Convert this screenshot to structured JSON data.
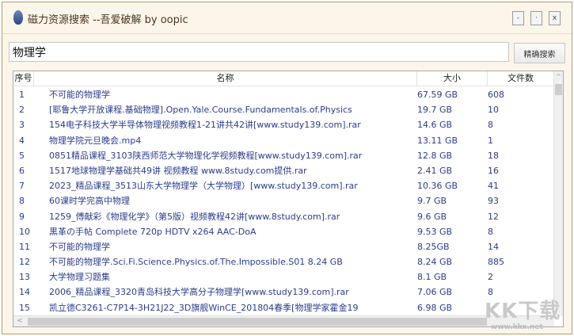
{
  "window": {
    "title": "磁力资源搜索 --吾爱破解 by oopic",
    "buttons": [
      "-",
      "·",
      "x"
    ]
  },
  "search": {
    "value": "物理学",
    "button_label": "精确搜索"
  },
  "table": {
    "headers": [
      "序号",
      "名称",
      "大小",
      "文件数"
    ],
    "rows": [
      [
        "1",
        "不可能的物理学",
        "67.59 GB",
        "608"
      ],
      [
        "2",
        "[耶鲁大学开放课程.基础物理].Open.Yale.Course.Fundamentals.of.Physics",
        "19.7 GB",
        "10"
      ],
      [
        "3",
        "154电子科技大学半导体物理视频教程1-21讲共42讲[www.study139.com].rar",
        "14.6 GB",
        "8"
      ],
      [
        "4",
        "物理学院元旦晚会.mp4",
        "13.11 GB",
        "1"
      ],
      [
        "5",
        "0851精品课程_3103陕西师范大学物理化学视频教程[www.study139.com].rar",
        "12.8 GB",
        "18"
      ],
      [
        "6",
        "1517地球物理学基础共49讲 视频教程 www.8study.com提供.rar",
        "2.41 GB",
        "16"
      ],
      [
        "7",
        "2023_精品课程_3513山东大学物理学（大学物理）[www.study139.com].rar",
        "10.36 GB",
        "41"
      ],
      [
        "8",
        "60课时学完高中物理",
        "9.7 GB",
        "93"
      ],
      [
        "9",
        "1259_傅献彩《物理化学》（第5版）视频教程42讲[www.8study.com].rar",
        "9.6 GB",
        "12"
      ],
      [
        "10",
        "黒革の手帖 Complete 720p HDTV x264 AAC-DoA",
        "9.53 GB",
        "8"
      ],
      [
        "11",
        "不可能的物理学",
        "8.25GB",
        "14"
      ],
      [
        "12",
        "不可能的物理学.Sci.Fi.Science.Physics.of.The.Impossible.S01 8.24 GB",
        "8.24 GB",
        "885"
      ],
      [
        "13",
        "大学物理习题集",
        "8.1 GB",
        "2"
      ],
      [
        "14",
        "2006_精品课程_3320青岛科技大学高分子物理学[www.study139.com].rar",
        "7.06 GB",
        "8"
      ],
      [
        "15",
        "凯立德C3261-C7P14-3H21J22_3D旗舰WinCE_201804春季[物理学家霍金19",
        "6.98 GB",
        ""
      ]
    ]
  },
  "watermark": {
    "text": "KK下载",
    "url": "www.kkx.net"
  }
}
